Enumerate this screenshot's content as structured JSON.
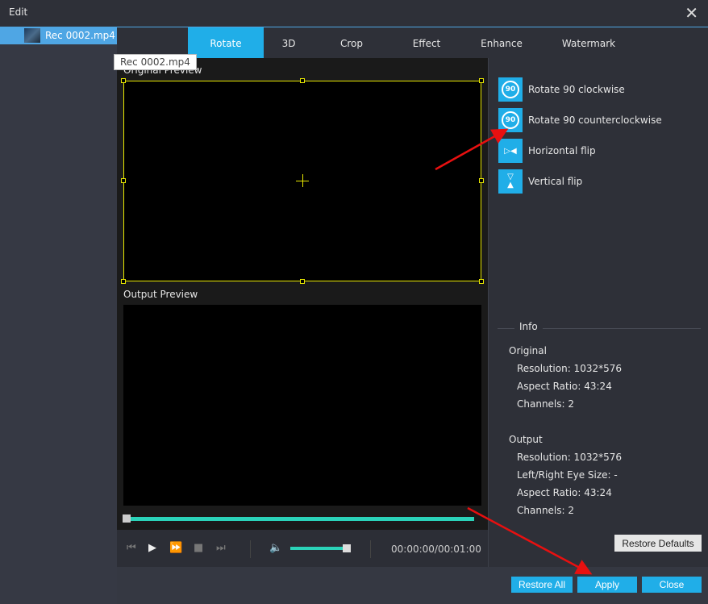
{
  "window": {
    "title": "Edit",
    "close_icon": "close-icon"
  },
  "sidebar": {
    "file": "Rec 0002.mp4",
    "tooltip": "Rec 0002.mp4"
  },
  "tabs": [
    "Rotate",
    "3D",
    "Crop",
    "Effect",
    "Enhance",
    "Watermark"
  ],
  "active_tab": "Rotate",
  "preview": {
    "original_label": "Original Preview",
    "output_label": "Output Preview",
    "time": "00:00:00/00:01:00",
    "progress": 0,
    "volume": 1.0
  },
  "options": [
    "Rotate 90 clockwise",
    "Rotate 90 counterclockwise",
    "Horizontal flip",
    "Vertical flip"
  ],
  "info": {
    "title": "Info",
    "original_label": "Original",
    "original": [
      "Resolution: 1032*576",
      "Aspect Ratio: 43:24",
      "Channels: 2"
    ],
    "output_label": "Output",
    "output": [
      "Resolution: 1032*576",
      "Left/Right Eye Size: -",
      "Aspect Ratio: 43:24",
      "Channels: 2"
    ]
  },
  "buttons": {
    "restore_defaults": "Restore Defaults",
    "restore_all": "Restore All",
    "apply": "Apply",
    "close": "Close"
  },
  "colors": {
    "accent": "#20aee8",
    "progress": "#2bd3b9",
    "crop_border": "#e8e800",
    "annotation_arrow": "#e81010"
  }
}
